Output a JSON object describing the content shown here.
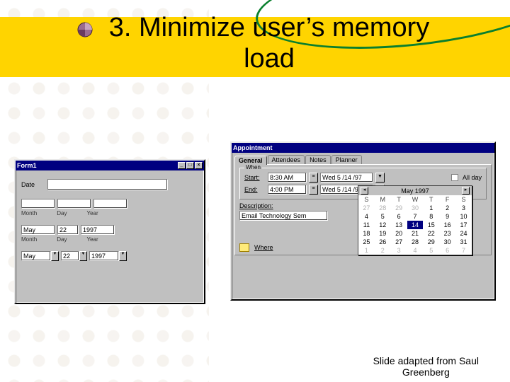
{
  "slide": {
    "title_line1": "3. Minimize user’s memory",
    "title_line2": "load",
    "attribution_line1": "Slide adapted from Saul",
    "attribution_line2": "Greenberg"
  },
  "form1": {
    "title": "Form1",
    "date_label": "Date",
    "labels": {
      "month": "Month",
      "day": "Day",
      "year": "Year"
    },
    "row1": {
      "month": "May",
      "day": "22",
      "year": "1997"
    },
    "row2": {
      "month": "May",
      "day": "22",
      "year": "1997"
    }
  },
  "appt": {
    "title": "Appointment",
    "tabs": [
      "General",
      "Attendees",
      "Notes",
      "Planner"
    ],
    "when_group": "When",
    "start_label": "Start:",
    "end_label": "End:",
    "start_time": "8:30 AM",
    "start_date": "Wed 5 /14 /97",
    "end_time": "4:00 PM",
    "end_date": "Wed 5 /14 /97",
    "allday_label": "All day",
    "description_label": "Description:",
    "description_value": "Email Technology Sem",
    "where_label": "Where"
  },
  "picker": {
    "month_label": "May 1997",
    "dow": [
      "S",
      "M",
      "T",
      "W",
      "T",
      "F",
      "S"
    ],
    "weeks": [
      [
        {
          "d": 27,
          "dim": true
        },
        {
          "d": 28,
          "dim": true
        },
        {
          "d": 29,
          "dim": true
        },
        {
          "d": 30,
          "dim": true
        },
        {
          "d": 1
        },
        {
          "d": 2
        },
        {
          "d": 3
        }
      ],
      [
        {
          "d": 4
        },
        {
          "d": 5
        },
        {
          "d": 6
        },
        {
          "d": 7
        },
        {
          "d": 8
        },
        {
          "d": 9
        },
        {
          "d": 10
        }
      ],
      [
        {
          "d": 11
        },
        {
          "d": 12
        },
        {
          "d": 13
        },
        {
          "d": 14,
          "sel": true
        },
        {
          "d": 15
        },
        {
          "d": 16
        },
        {
          "d": 17
        }
      ],
      [
        {
          "d": 18
        },
        {
          "d": 19
        },
        {
          "d": 20
        },
        {
          "d": 21
        },
        {
          "d": 22
        },
        {
          "d": 23
        },
        {
          "d": 24
        }
      ],
      [
        {
          "d": 25
        },
        {
          "d": 26
        },
        {
          "d": 27
        },
        {
          "d": 28
        },
        {
          "d": 29
        },
        {
          "d": 30
        },
        {
          "d": 31
        }
      ],
      [
        {
          "d": 1,
          "dim": true
        },
        {
          "d": 2,
          "dim": true
        },
        {
          "d": 3,
          "dim": true
        },
        {
          "d": 4,
          "dim": true
        },
        {
          "d": 5,
          "dim": true
        },
        {
          "d": 6,
          "dim": true
        },
        {
          "d": 7,
          "dim": true
        }
      ]
    ]
  }
}
